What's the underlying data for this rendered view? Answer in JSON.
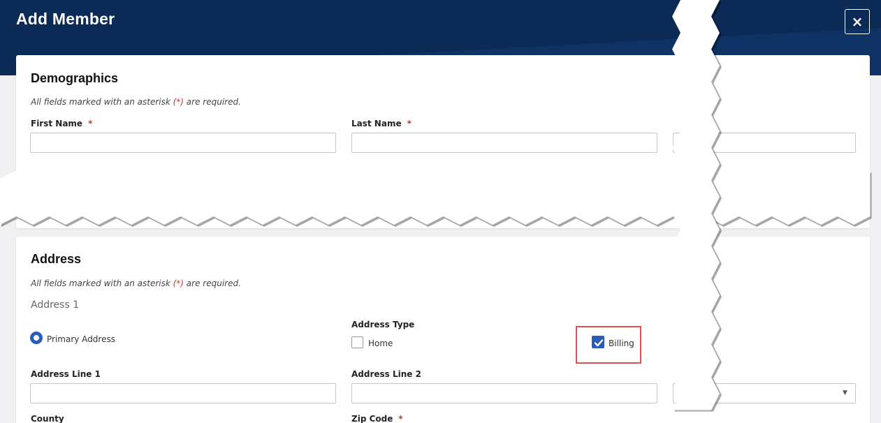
{
  "modal": {
    "title": "Add Member",
    "close_label": "×"
  },
  "demographics": {
    "heading": "Demographics",
    "required_note_prefix": "All fields marked with an asterisk ",
    "required_note_marker": "(*)",
    "required_note_suffix": " are required.",
    "fields": {
      "first_name": {
        "label": "First Name",
        "required": "*",
        "value": ""
      },
      "last_name": {
        "label": "Last Name",
        "required": "*",
        "value": ""
      }
    }
  },
  "address": {
    "heading": "Address",
    "required_note_prefix": "All fields marked with an asterisk ",
    "required_note_marker": "(*)",
    "required_note_suffix": " are required.",
    "subheading": "Address 1",
    "primary_address_label": "Primary Address",
    "address_type": {
      "label": "Address Type",
      "options": [
        {
          "label": "Home",
          "checked": false
        },
        {
          "label": "Billing",
          "checked": true
        }
      ]
    },
    "fields": {
      "line1": {
        "label": "Address Line 1",
        "value": ""
      },
      "line2": {
        "label": "Address Line 2",
        "value": ""
      },
      "county": {
        "label": "County"
      },
      "zip": {
        "label": "Zip Code",
        "required": "*"
      }
    },
    "dropdown_arrow": "▼"
  },
  "colors": {
    "header": "#0b2a55",
    "accent": "#2c5bb8",
    "required": "#c0392b",
    "highlight": "#d9534f"
  }
}
